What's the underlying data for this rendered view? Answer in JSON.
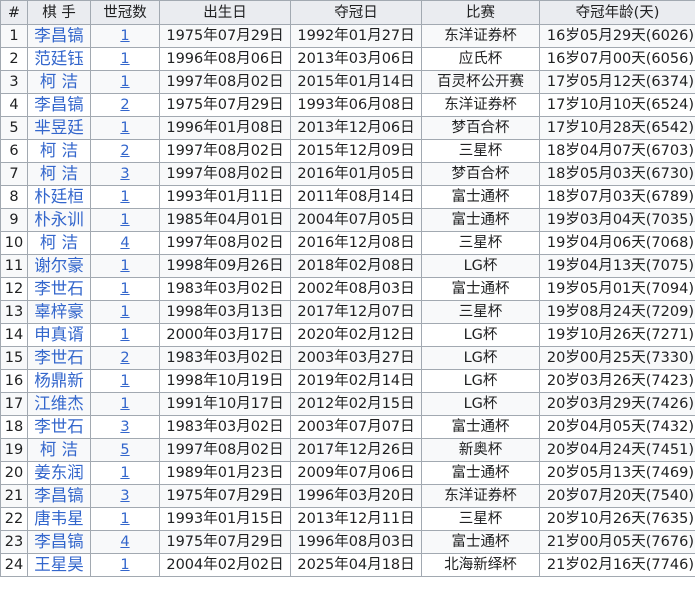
{
  "headers": [
    "#",
    "棋 手",
    "世冠数",
    "出生日",
    "夺冠日",
    "比赛",
    "夺冠年龄(天)"
  ],
  "rows": [
    {
      "num": "1",
      "player": "李昌镐",
      "count": "1",
      "birth": "1975年07月29日",
      "win": "1992年01月27日",
      "event": "东洋证券杯",
      "age": "16岁05月29天(6026)"
    },
    {
      "num": "2",
      "player": "范廷钰",
      "count": "1",
      "birth": "1996年08月06日",
      "win": "2013年03月06日",
      "event": "应氏杯",
      "age": "16岁07月00天(6056)"
    },
    {
      "num": "3",
      "player": "柯 洁",
      "count": "1",
      "birth": "1997年08月02日",
      "win": "2015年01月14日",
      "event": "百灵杯公开赛",
      "age": "17岁05月12天(6374)"
    },
    {
      "num": "4",
      "player": "李昌镐",
      "count": "2",
      "birth": "1975年07月29日",
      "win": "1993年06月08日",
      "event": "东洋证券杯",
      "age": "17岁10月10天(6524)"
    },
    {
      "num": "5",
      "player": "芈昱廷",
      "count": "1",
      "birth": "1996年01月08日",
      "win": "2013年12月06日",
      "event": "梦百合杯",
      "age": "17岁10月28天(6542)"
    },
    {
      "num": "6",
      "player": "柯 洁",
      "count": "2",
      "birth": "1997年08月02日",
      "win": "2015年12月09日",
      "event": "三星杯",
      "age": "18岁04月07天(6703)"
    },
    {
      "num": "7",
      "player": "柯 洁",
      "count": "3",
      "birth": "1997年08月02日",
      "win": "2016年01月05日",
      "event": "梦百合杯",
      "age": "18岁05月03天(6730)"
    },
    {
      "num": "8",
      "player": "朴廷桓",
      "count": "1",
      "birth": "1993年01月11日",
      "win": "2011年08月14日",
      "event": "富士通杯",
      "age": "18岁07月03天(6789)"
    },
    {
      "num": "9",
      "player": "朴永训",
      "count": "1",
      "birth": "1985年04月01日",
      "win": "2004年07月05日",
      "event": "富士通杯",
      "age": "19岁03月04天(7035)"
    },
    {
      "num": "10",
      "player": "柯 洁",
      "count": "4",
      "birth": "1997年08月02日",
      "win": "2016年12月08日",
      "event": "三星杯",
      "age": "19岁04月06天(7068)"
    },
    {
      "num": "11",
      "player": "谢尔豪",
      "count": "1",
      "birth": "1998年09月26日",
      "win": "2018年02月08日",
      "event": "LG杯",
      "age": "19岁04月13天(7075)"
    },
    {
      "num": "12",
      "player": "李世石",
      "count": "1",
      "birth": "1983年03月02日",
      "win": "2002年08月03日",
      "event": "富士通杯",
      "age": "19岁05月01天(7094)"
    },
    {
      "num": "13",
      "player": "辜梓豪",
      "count": "1",
      "birth": "1998年03月13日",
      "win": "2017年12月07日",
      "event": "三星杯",
      "age": "19岁08月24天(7209)"
    },
    {
      "num": "14",
      "player": "申真谞",
      "count": "1",
      "birth": "2000年03月17日",
      "win": "2020年02月12日",
      "event": "LG杯",
      "age": "19岁10月26天(7271)"
    },
    {
      "num": "15",
      "player": "李世石",
      "count": "2",
      "birth": "1983年03月02日",
      "win": "2003年03月27日",
      "event": "LG杯",
      "age": "20岁00月25天(7330)"
    },
    {
      "num": "16",
      "player": "杨鼎新",
      "count": "1",
      "birth": "1998年10月19日",
      "win": "2019年02月14日",
      "event": "LG杯",
      "age": "20岁03月26天(7423)"
    },
    {
      "num": "17",
      "player": "江维杰",
      "count": "1",
      "birth": "1991年10月17日",
      "win": "2012年02月15日",
      "event": "LG杯",
      "age": "20岁03月29天(7426)"
    },
    {
      "num": "18",
      "player": "李世石",
      "count": "3",
      "birth": "1983年03月02日",
      "win": "2003年07月07日",
      "event": "富士通杯",
      "age": "20岁04月05天(7432)"
    },
    {
      "num": "19",
      "player": "柯 洁",
      "count": "5",
      "birth": "1997年08月02日",
      "win": "2017年12月26日",
      "event": "新奥杯",
      "age": "20岁04月24天(7451)"
    },
    {
      "num": "20",
      "player": "姜东润",
      "count": "1",
      "birth": "1989年01月23日",
      "win": "2009年07月06日",
      "event": "富士通杯",
      "age": "20岁05月13天(7469)"
    },
    {
      "num": "21",
      "player": "李昌镐",
      "count": "3",
      "birth": "1975年07月29日",
      "win": "1996年03月20日",
      "event": "东洋证券杯",
      "age": "20岁07月20天(7540)"
    },
    {
      "num": "22",
      "player": "唐韦星",
      "count": "1",
      "birth": "1993年01月15日",
      "win": "2013年12月11日",
      "event": "三星杯",
      "age": "20岁10月26天(7635)"
    },
    {
      "num": "23",
      "player": "李昌镐",
      "count": "4",
      "birth": "1975年07月29日",
      "win": "1996年08月03日",
      "event": "富士通杯",
      "age": "21岁00月05天(7676)"
    },
    {
      "num": "24",
      "player": "王星昊",
      "count": "1",
      "birth": "2004年02月02日",
      "win": "2025年04月18日",
      "event": "北海新绎杯",
      "age": "21岁02月16天(7746)"
    }
  ],
  "colors": {
    "header_bg": "#eaecf0",
    "border": "#a2a9b1",
    "link": "#3366cc",
    "row_alt": "#f8f9fa"
  }
}
